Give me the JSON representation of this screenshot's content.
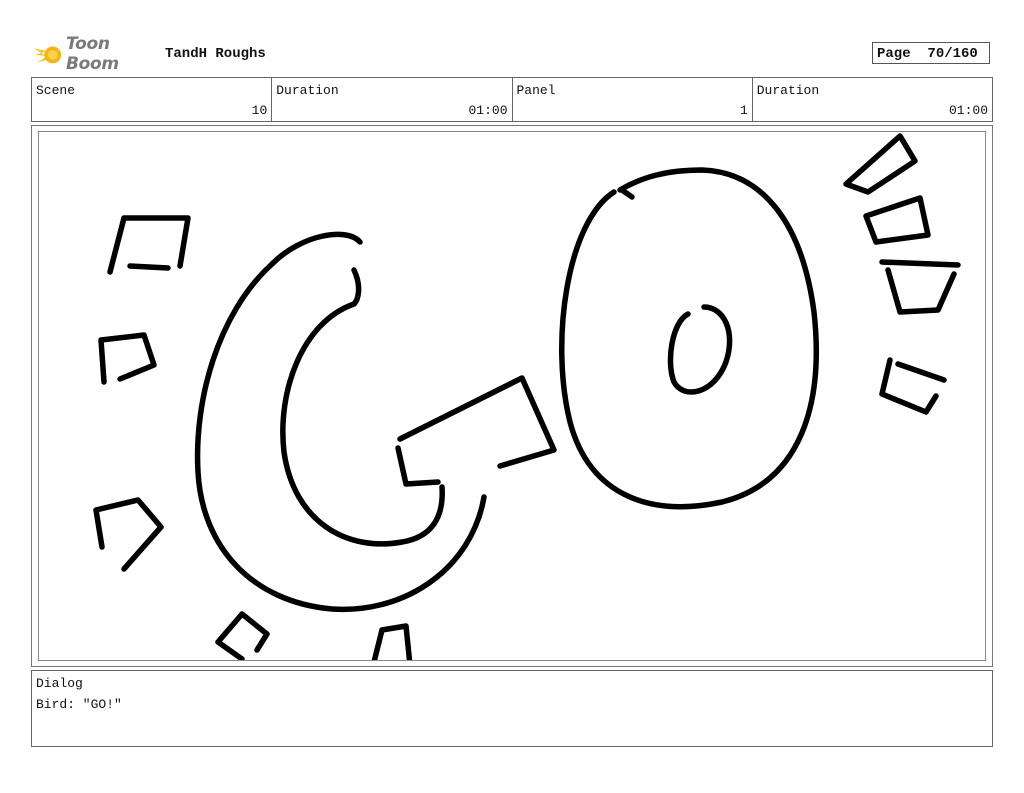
{
  "header": {
    "logo_text": "Toon Boom",
    "project_title": "TandH Roughs",
    "page_label": "Page",
    "page_value": "70/160"
  },
  "info": {
    "scene_label": "Scene",
    "scene_value": "10",
    "scene_duration_label": "Duration",
    "scene_duration_value": "01:00",
    "panel_label": "Panel",
    "panel_value": "1",
    "panel_duration_label": "Duration",
    "panel_duration_value": "01:00"
  },
  "dialog": {
    "label": "Dialog",
    "text": "Bird: \"GO!\""
  }
}
